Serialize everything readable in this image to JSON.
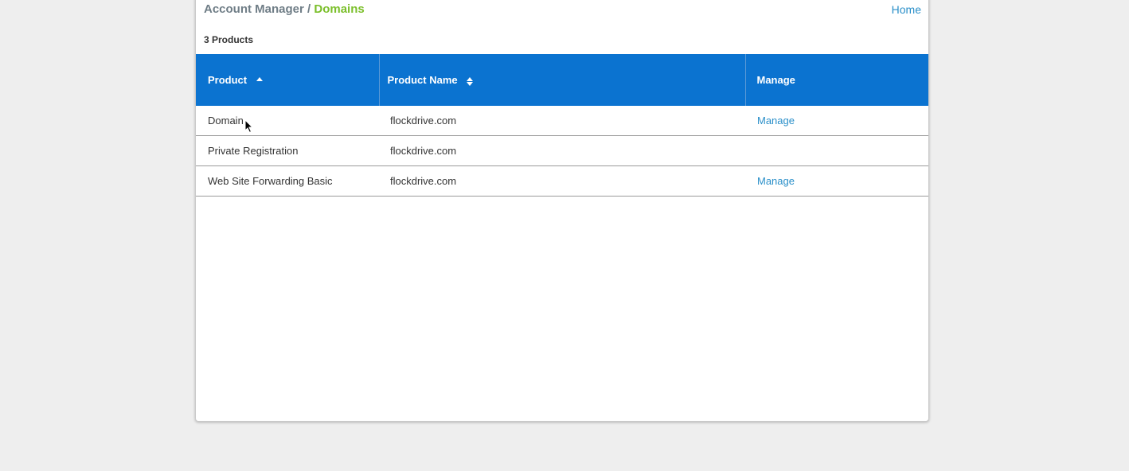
{
  "breadcrumb": {
    "parent": "Account Manager",
    "separator": "/",
    "current": "Domains"
  },
  "nav": {
    "home_label": "Home"
  },
  "products_count_label": "3 Products",
  "table": {
    "columns": [
      {
        "label": "Product",
        "sort": "ascending"
      },
      {
        "label": "Product Name",
        "sort": "sortable"
      },
      {
        "label": "Manage",
        "sort": "none"
      }
    ],
    "rows": [
      {
        "product": "Domain",
        "product_name": "flockdrive.com",
        "manage": "Manage"
      },
      {
        "product": "Private Registration",
        "product_name": "flockdrive.com",
        "manage": ""
      },
      {
        "product": "Web Site Forwarding Basic",
        "product_name": "flockdrive.com",
        "manage": "Manage"
      }
    ]
  },
  "colors": {
    "header_bg": "#0b73d0",
    "link": "#2a8fc9",
    "breadcrumb_current": "#7bbf2a",
    "page_bg": "#eeeeee"
  }
}
